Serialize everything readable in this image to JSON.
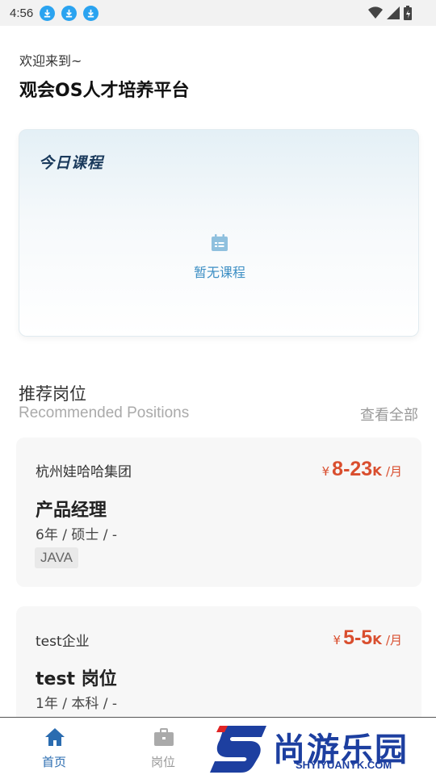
{
  "status_bar": {
    "time": "4:56"
  },
  "header": {
    "greeting": "欢迎来到~",
    "title": "观会OS人才培养平台"
  },
  "course_card": {
    "logo_text": "今日课程",
    "empty_text": "暂无课程"
  },
  "recommended": {
    "title": "推荐岗位",
    "subtitle": "Recommended Positions",
    "view_all": "查看全部"
  },
  "jobs": [
    {
      "company": "杭州娃哈哈集团",
      "currency": "¥",
      "salary_range": "8-23",
      "salary_k": "K",
      "salary_unit": "/月",
      "title": "产品经理",
      "requirements": "6年 / 硕士 / -",
      "tag": "JAVA"
    },
    {
      "company": "test企业",
      "currency": "¥",
      "salary_range": "5-5",
      "salary_k": "K",
      "salary_unit": "/月",
      "title": "test 岗位",
      "requirements": "1年 / 本科 / -"
    }
  ],
  "bottom_nav": {
    "home_label": "首页",
    "jobs_label": "岗位",
    "active_color": "#2b6cb0",
    "inactive_color": "#999999"
  },
  "watermark": {
    "text": "尚游乐园",
    "url": "SHYIYUANYK.COM"
  }
}
